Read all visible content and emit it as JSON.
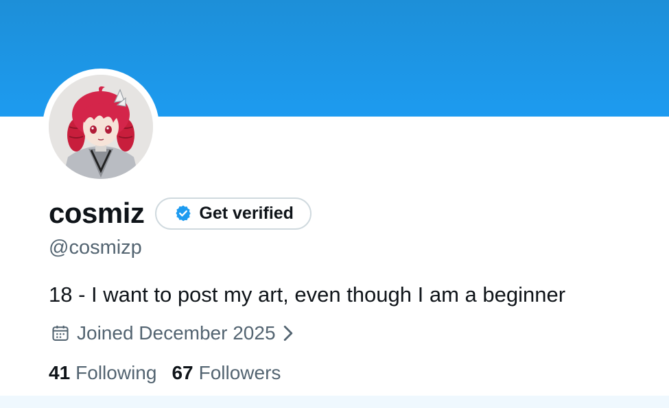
{
  "profile": {
    "display_name": "cosmiz",
    "handle": "@cosmizp",
    "bio": "18 - I want to post my art, even though I am a beginner",
    "joined": "Joined December 2025"
  },
  "verify": {
    "label": "Get verified",
    "icon": "verified-badge-icon"
  },
  "stats": {
    "following_count": "41",
    "following_label": "Following",
    "followers_count": "67",
    "followers_label": "Followers"
  },
  "colors": {
    "banner": "#1d9bf0",
    "accent": "#1d9bf0",
    "secondary_text": "#536471",
    "primary_text": "#0f1419"
  }
}
